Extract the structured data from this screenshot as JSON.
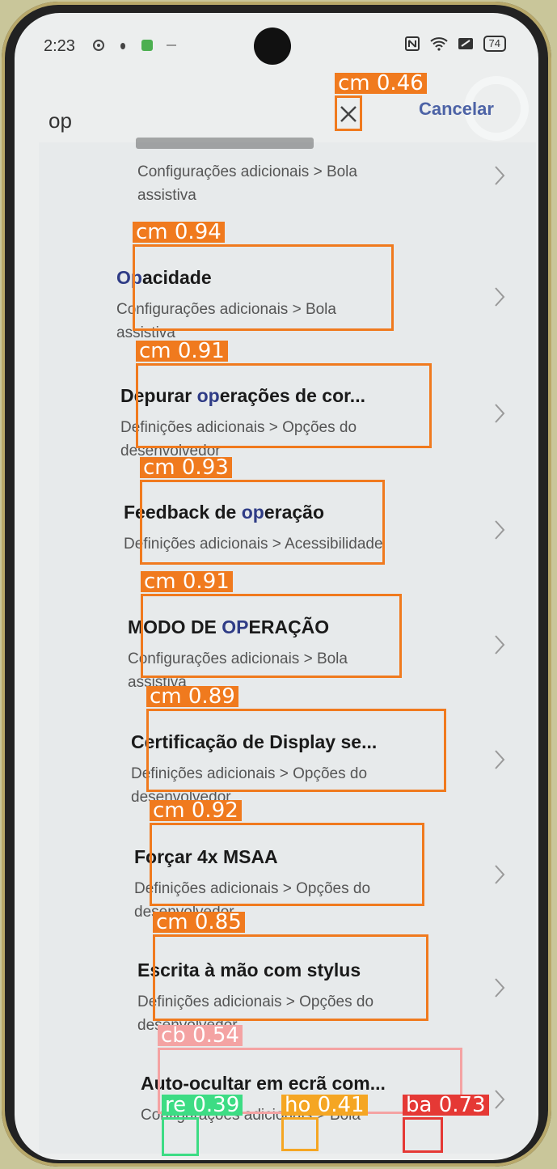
{
  "status_bar": {
    "time": "2:23",
    "battery": "74"
  },
  "search": {
    "query": "op",
    "cancel_label": "Cancelar"
  },
  "results": [
    {
      "title": "",
      "path": "Configurações adicionais > Bola assistiva"
    },
    {
      "title_pre": "",
      "title_hl": "Op",
      "title_post": "acidade",
      "path": "Configurações adicionais > Bola assistiva"
    },
    {
      "title_pre": "Depurar ",
      "title_hl": "op",
      "title_post": "erações de cor...",
      "path": "Definições adicionais > Opções do desenvolvedor"
    },
    {
      "title_pre": "Feedback de ",
      "title_hl": "op",
      "title_post": "eração",
      "path": "Definições adicionais > Acessibilidade"
    },
    {
      "title_pre": "MODO DE ",
      "title_hl": "OP",
      "title_post": "ERAÇÃO",
      "path": "Configurações adicionais > Bola assistiva"
    },
    {
      "title_pre": "Certificação de Display se...",
      "title_hl": "",
      "title_post": "",
      "path": "Definições adicionais > Opções do desenvolvedor"
    },
    {
      "title_pre": "Forçar 4x MSAA",
      "title_hl": "",
      "title_post": "",
      "path": "Definições adicionais > Opções do desenvolvedor"
    },
    {
      "title_pre": "Escrita à mão com stylus",
      "title_hl": "",
      "title_post": "",
      "path": "Definições adicionais > Opções do desenvolvedor"
    },
    {
      "title_pre": "Auto-ocultar em ecrã com...",
      "title_hl": "",
      "title_post": "",
      "path": "Configurações adicionais > Bola"
    }
  ],
  "detections": {
    "clear": "cm 0.46",
    "r1": "cm 0.94",
    "r2": "cm 0.91",
    "r3": "cm 0.93",
    "r4": "cm 0.91",
    "r5": "cm 0.89",
    "r6": "cm 0.92",
    "r7": "cm 0.85",
    "r8": "cb 0.54",
    "recent": "re 0.39",
    "home": "ho 0.41",
    "back": "ba 0.73"
  },
  "colors": {
    "highlight": "#2f3c86",
    "det_cm": "#f07a1e",
    "det_cb": "#f4a3a3",
    "det_re": "#3ddc84",
    "det_ho": "#f5a623",
    "det_ba": "#e53935"
  }
}
